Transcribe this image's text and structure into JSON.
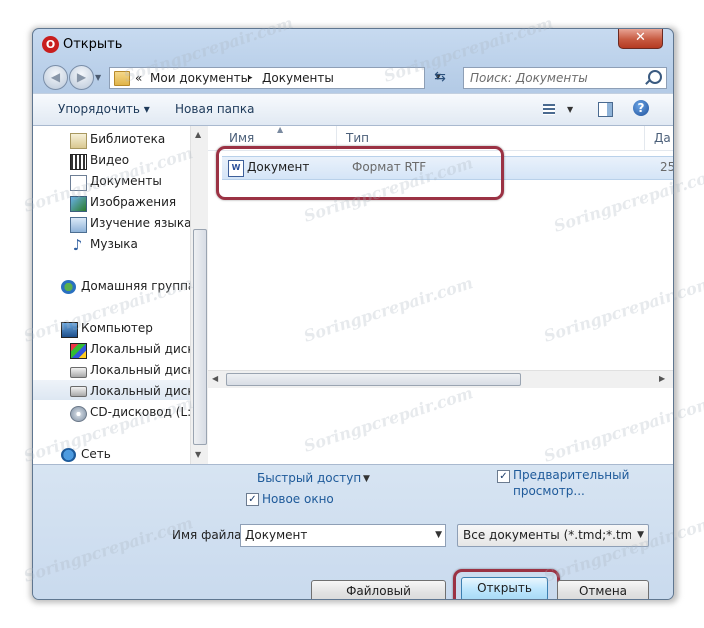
{
  "window": {
    "title": "Открыть",
    "app_icon_letter": "O",
    "close_label": "✕"
  },
  "navigation": {
    "back_icon": "back-arrow-icon",
    "forward_icon": "forward-arrow-icon",
    "address_prefix": "«",
    "address_parts": [
      "Мои документы",
      "Документы"
    ],
    "address_separator": "▸",
    "search_placeholder": "Поиск: Документы"
  },
  "toolbar": {
    "organize_label": "Упорядочить ▾",
    "new_folder_label": "Новая папка",
    "help_label": "?"
  },
  "sidebar": {
    "items": [
      {
        "label": "Библиотека",
        "icon": "library-icon"
      },
      {
        "label": "Видео",
        "icon": "video-icon"
      },
      {
        "label": "Документы",
        "icon": "documents-icon"
      },
      {
        "label": "Изображения",
        "icon": "images-icon"
      },
      {
        "label": "Изучение языка",
        "icon": "language-icon"
      },
      {
        "label": "Музыка",
        "icon": "music-icon"
      },
      {
        "label": "Домашняя группа",
        "icon": "homegroup-icon"
      },
      {
        "label": "Компьютер",
        "icon": "computer-icon"
      },
      {
        "label": "Локальный диск (",
        "icon": "system-disk-icon"
      },
      {
        "label": "Локальный диск (",
        "icon": "disk-icon"
      },
      {
        "label": "Локальный диск (",
        "icon": "disk-icon"
      },
      {
        "label": "CD-дисковод (L:)",
        "icon": "cd-icon"
      },
      {
        "label": "Сеть",
        "icon": "network-icon"
      }
    ]
  },
  "file_list": {
    "columns": [
      "Имя",
      "Тип",
      "Да"
    ],
    "rows": [
      {
        "name": "Документ",
        "type": "Формат RTF",
        "date": "25"
      }
    ]
  },
  "options": {
    "quick_access_label": "Быстрый доступ",
    "new_window_label": "Новое окно",
    "new_window_checked": "✓",
    "preview_label_line1": "Предварительный",
    "preview_label_line2": "просмотр...",
    "preview_checked": "✓"
  },
  "filename": {
    "label": "Имя файла:",
    "value": "Документ",
    "filter_value": "Все документы (*.tmd;*.tmv;*."
  },
  "buttons": {
    "file_manager_label": "Файловый менеджер...",
    "open_label": "Открыть",
    "cancel_label": "Отмена"
  },
  "watermark": "Soringpcrepair.com",
  "colors": {
    "highlight_border": "#9b3244",
    "window_frame": "#b9d0ea",
    "selection": "#d5e5f7",
    "link_blue": "#1e5a9a"
  }
}
